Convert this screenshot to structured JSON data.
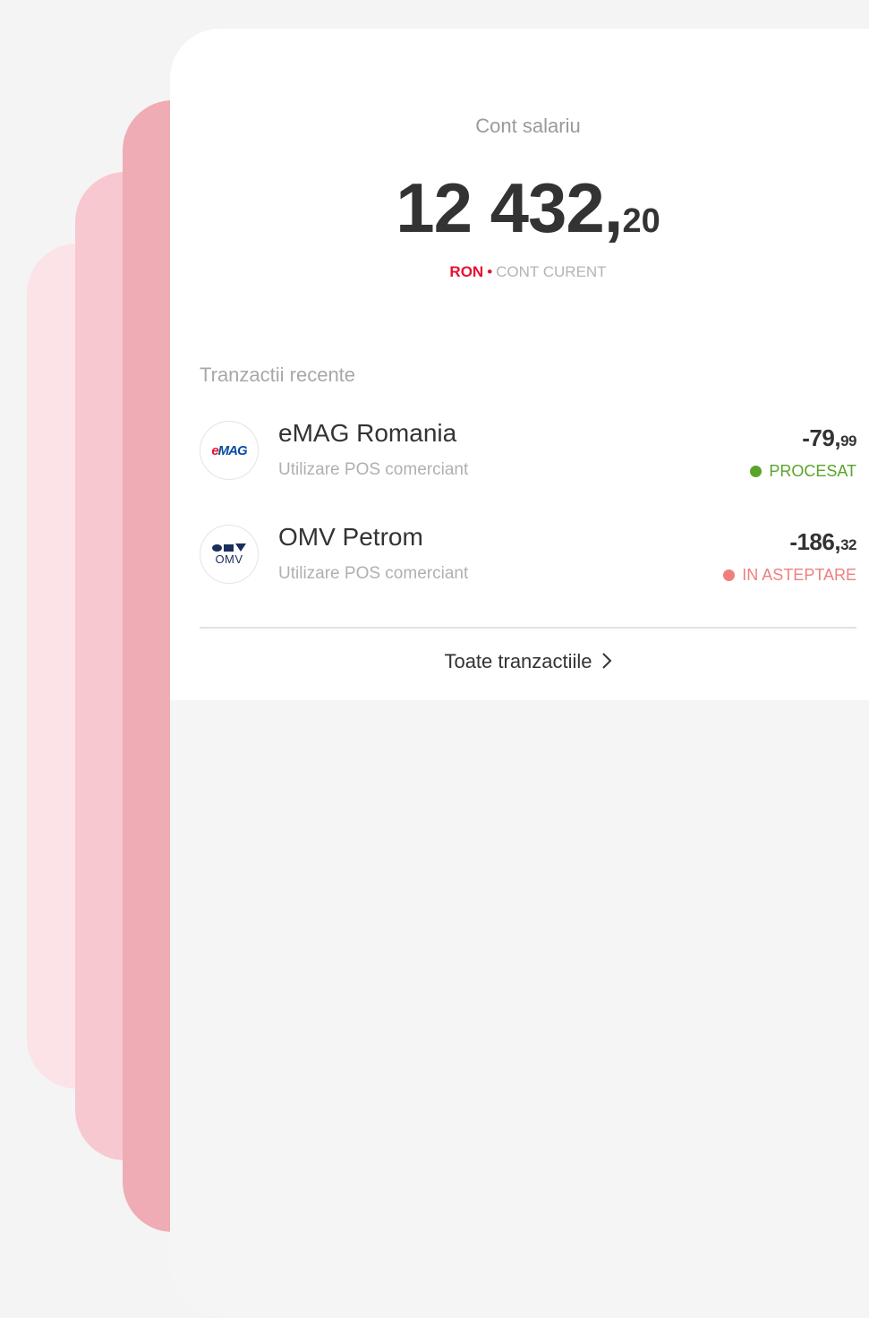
{
  "account": {
    "name": "Cont salariu",
    "balance_int": "12 432,",
    "balance_dec": "20",
    "currency": "RON",
    "separator": "•",
    "type": "CONT CURENT"
  },
  "transactions_section": {
    "title": "Tranzactii recente",
    "items": [
      {
        "merchant": "eMAG Romania",
        "description": "Utilizare POS comerciant",
        "amount_int": "-79,",
        "amount_dec": "99",
        "status": "PROCESAT",
        "status_color": "#5aa42a",
        "logo": "emag-logo",
        "logo_text": "eMAG"
      },
      {
        "merchant": "OMV Petrom",
        "description": "Utilizare POS comerciant",
        "amount_int": "-186,",
        "amount_dec": "32",
        "status": "IN ASTEPTARE",
        "status_color": "#ef7f7f",
        "logo": "omv-logo",
        "logo_text": "OMV"
      }
    ],
    "all_link": "Toate tranzactiile"
  },
  "colors": {
    "brand_red": "#e8102e",
    "stack_card_light": "#fbe3e7",
    "stack_card_mid": "#f8c8d0",
    "stack_card_dark": "#efacb5"
  }
}
